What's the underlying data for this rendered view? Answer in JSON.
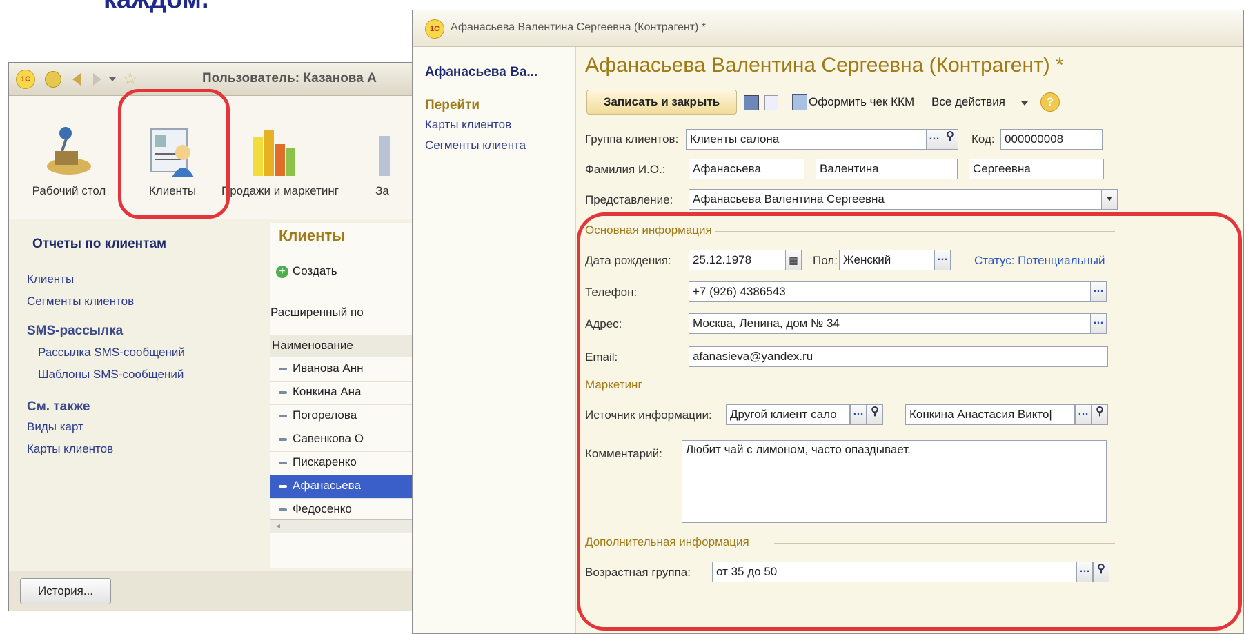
{
  "heading_fragment": "каждом.",
  "left_window": {
    "title": "Пользователь: Казанова А",
    "sections": [
      "Рабочий стол",
      "Клиенты",
      "Продажи и маркетинг",
      "За"
    ],
    "nav": {
      "reports_header": "Отчеты по клиентам",
      "reports_links": [
        "Клиенты",
        "Сегменты клиентов"
      ],
      "sms_header": "SMS-рассылка",
      "sms_links": [
        "Рассылка SMS-сообщений",
        "Шаблоны SMS-сообщений"
      ],
      "see_also_header": "См. также",
      "see_also_links": [
        "Виды карт",
        "Карты клиентов"
      ]
    },
    "list": {
      "title": "Клиенты",
      "create_label": "Создать",
      "search_label": "Расширенный по",
      "column": "Наименование",
      "rows": [
        "Иванова Анн",
        "Конкина Ана",
        "Погорелова",
        "Савенкова О",
        "Пискаренко",
        "Афанасьева",
        "Федосенко"
      ],
      "selected_index": 5
    },
    "history_button": "История..."
  },
  "right_window": {
    "title": "Афанасьева Валентина Сергеевна (Контрагент) *",
    "nav": {
      "name": "Афанасьева Ва...",
      "goto_header": "Перейти",
      "links": [
        "Карты клиентов",
        "Сегменты клиента"
      ]
    },
    "form_title": "Афанасьева Валентина Сергеевна (Контрагент) *",
    "toolbar": {
      "save_close": "Записать и закрыть",
      "kkm": "Оформить чек ККМ",
      "all_actions": "Все действия"
    },
    "fields": {
      "group_label": "Группа клиентов:",
      "group_value": "Клиенты салона",
      "code_label": "Код:",
      "code_value": "000000008",
      "fio_label": "Фамилия И.О.:",
      "last_name": "Афанасьева",
      "first_name": "Валентина",
      "middle_name": "Сергеевна",
      "presentation_label": "Представление:",
      "presentation_value": "Афанасьева Валентина Сергеевна",
      "basic_info_group": "Основная информация",
      "birth_label": "Дата рождения:",
      "birth_value": "25.12.1978",
      "gender_label": "Пол:",
      "gender_value": "Женский",
      "status_link": "Статус: Потенциальный",
      "phone_label": "Телефон:",
      "phone_value": "+7 (926) 4386543",
      "address_label": "Адрес:",
      "address_value": "Москва, Ленина, дом № 34",
      "email_label": "Email:",
      "email_value": "afanasieva@yandex.ru",
      "marketing_group": "Маркетинг",
      "source_label": "Источник информации:",
      "source_value": "Другой клиент сало",
      "source_client": "Конкина Анастасия Викто|",
      "comment_label": "Комментарий:",
      "comment_value": "Любит чай с лимоном, часто опаздывает.",
      "additional_group": "Дополнительная информация",
      "age_label": "Возрастная группа:",
      "age_value": "от 35 до 50"
    }
  },
  "colors": {
    "highlight": "#e2363a",
    "accent_gold": "#a07a16",
    "selection": "#3a5fc9"
  }
}
